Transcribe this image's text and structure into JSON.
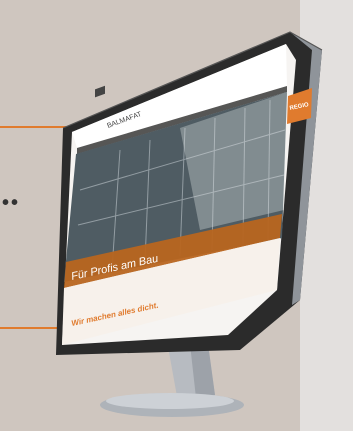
{
  "monitor": {
    "brand_logo_text": "BALMAFAT",
    "hero_caption": "Für Profis am Bau",
    "tagline": "Wir machen alles dicht.",
    "orange_corner_badge": "REGIO"
  },
  "colors": {
    "background_panel": "#cfc6bf",
    "background_right": "#e3e0de",
    "accent_orange": "#e07b2e",
    "device_frame": "#2c2c2c",
    "device_silver": "#b8bcc2"
  },
  "decor": {
    "dots": "••"
  }
}
